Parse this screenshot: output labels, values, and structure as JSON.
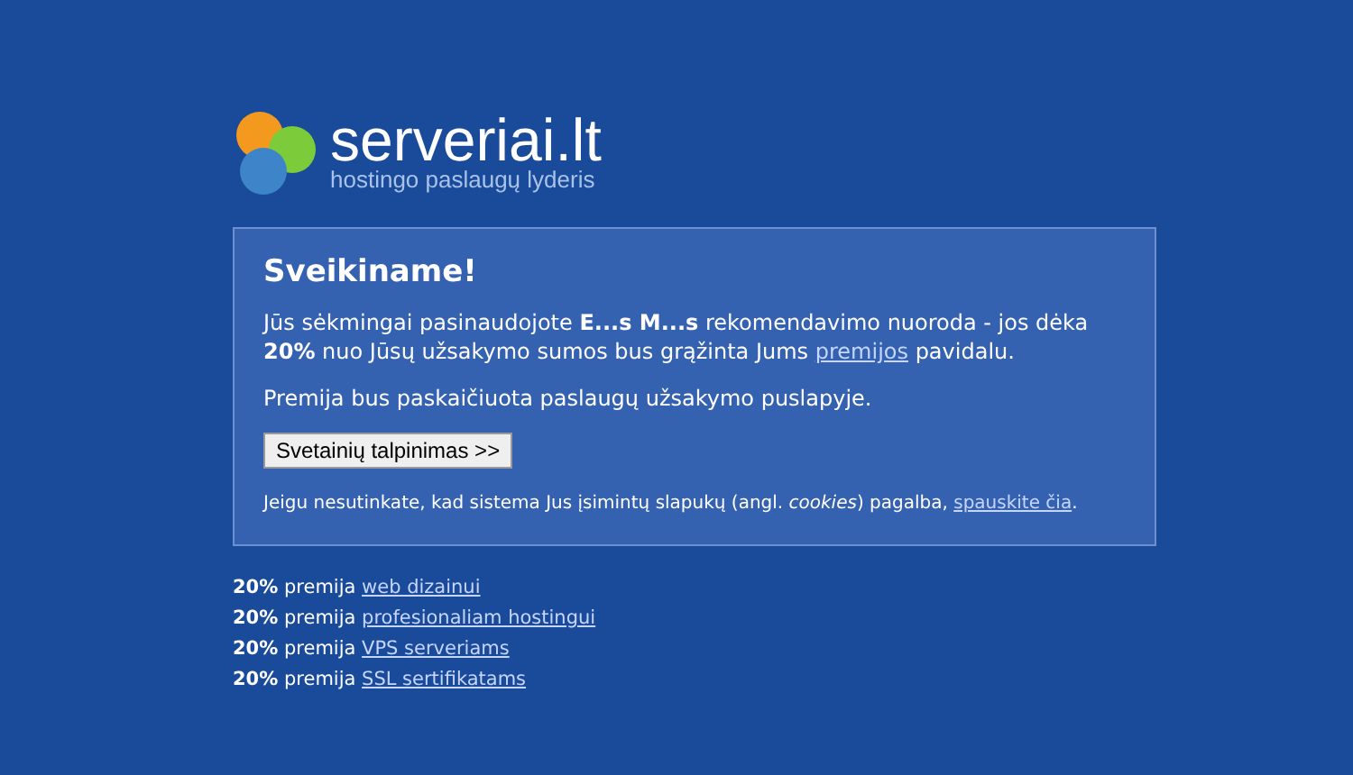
{
  "logo": {
    "name": "serveriai.lt",
    "tagline": "hostingo paslaugų lyderis"
  },
  "card": {
    "title": "Sveikiname!",
    "intro": {
      "before": "Jūs sėkmingai pasinaudojote **E...s M...s** rekomendavimo nuoroda - jos dėka **20%** nuo Jūsų užsakymo sumos bus grąžinta Jums ",
      "link": "premijos",
      "after": " pavidalu."
    },
    "note": "Premija bus paskaičiuota paslaugų užsakymo puslapyje.",
    "button": "Svetainių talpinimas >>",
    "cookies": {
      "before": "Jeigu nesutinkate, kad sistema Jus įsimintų slapukų (angl. *cookies*) pagalba, ",
      "link": "spauskite čia",
      "after": "."
    }
  },
  "bonuses": [
    {
      "text": "**20%** premija ",
      "link": "web dizainui"
    },
    {
      "text": "**20%** premija ",
      "link": "profesionaliam hostingui"
    },
    {
      "text": "**20%** premija ",
      "link": "VPS serveriams"
    },
    {
      "text": "**20%** premija ",
      "link": "SSL sertifikatams"
    }
  ]
}
